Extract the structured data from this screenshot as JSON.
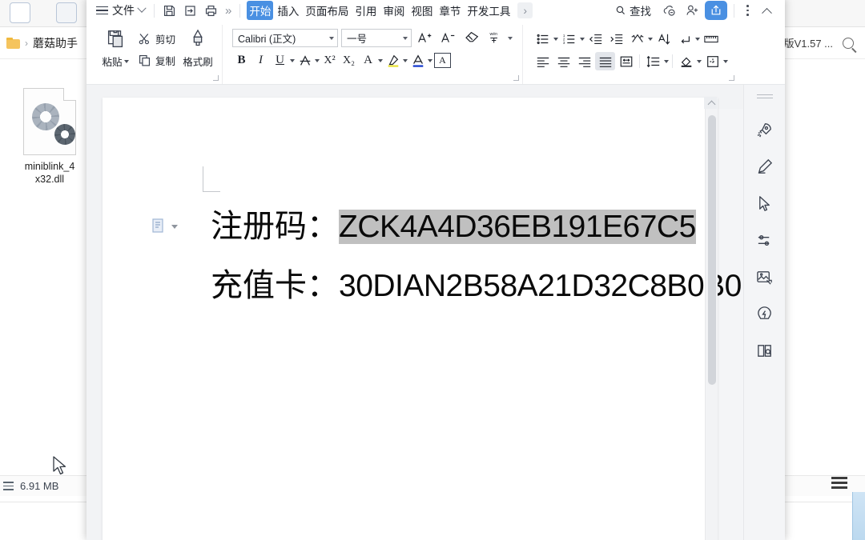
{
  "explorer": {
    "breadcrumb_folder_icon": "folder-icon",
    "breadcrumb_sep": "›",
    "breadcrumb_text": "蘑菇助手",
    "right_breadcrumb_sep": "›",
    "right_breadcrumb_text": "版V1.57 ...",
    "search_icon": "search-icon",
    "file": {
      "icon": "dll-gears-icon",
      "name_line1": "miniblink_4",
      "name_line2": "x32.dll"
    },
    "status": {
      "list_icon": "list-view-icon",
      "size_text": "6.91 MB"
    },
    "cursor": "mouse-cursor"
  },
  "wps": {
    "menubar": {
      "hamburger_icon": "hamburger-icon",
      "file_label": "文件",
      "file_caret_icon": "chevron-down-icon",
      "quick_icons": [
        "save-icon",
        "export-pdf-icon",
        "print-icon"
      ],
      "quick_more": "»",
      "tabs": [
        {
          "label": "开始",
          "active": true
        },
        {
          "label": "插入",
          "active": false
        },
        {
          "label": "页面布局",
          "active": false
        },
        {
          "label": "引用",
          "active": false
        },
        {
          "label": "审阅",
          "active": false
        },
        {
          "label": "视图",
          "active": false
        },
        {
          "label": "章节",
          "active": false
        },
        {
          "label": "开发工具",
          "active": false
        }
      ],
      "tabs_overflow": "›",
      "find_icon": "search-icon",
      "find_label": "查找",
      "cloud_icon": "cloud-off-icon",
      "add_user_icon": "add-user-icon",
      "share_icon": "share-icon",
      "overflow_icon": "more-vertical-icon",
      "collapse_icon": "chevron-up-icon"
    },
    "ribbon": {
      "clipboard": {
        "paste_icon": "paste-icon",
        "paste_label": "粘贴",
        "cut_icon": "scissors-icon",
        "cut_label": "剪切",
        "copy_icon": "copy-icon",
        "copy_label": "复制",
        "format_painter_icon": "format-painter-icon",
        "format_painter_label": "格式刷"
      },
      "font": {
        "font_name": "Calibri (正文)",
        "font_size": "一号",
        "grow_font_icon": "increase-font-icon",
        "shrink_font_icon": "decrease-font-icon",
        "clear_format_icon": "clear-format-icon",
        "pinyin_icon": "pinyin-guide-icon",
        "bold_label": "B",
        "italic_label": "I",
        "underline_label": "U",
        "strikethrough_icon": "strikethrough-icon",
        "superscript_label": "X²",
        "subscript_label": "X₂",
        "text_effect_label": "A",
        "highlight_icon": "highlight-icon",
        "font_color_icon": "font-color-icon",
        "char_border_label": "A"
      },
      "paragraph": {
        "bullets_icon": "bullet-list-icon",
        "numbering_icon": "numbered-list-icon",
        "decrease_indent_icon": "decrease-indent-icon",
        "increase_indent_icon": "increase-indent-icon",
        "smart_layout_icon": "smart-layout-icon",
        "sort_icon": "sort-icon",
        "show_marks_icon": "show-paragraph-marks-icon",
        "ruler_icon": "ruler-icon",
        "align_left_icon": "align-left-icon",
        "align_center_icon": "align-center-icon",
        "align_right_icon": "align-right-icon",
        "align_justify_icon": "align-justify-icon",
        "distribute_icon": "distribute-text-icon",
        "line_spacing_icon": "line-spacing-icon",
        "shading_icon": "shading-icon",
        "borders_icon": "borders-icon"
      }
    },
    "document": {
      "paste_options_icon": "paste-options-icon",
      "paste_options_caret": "chevron-down-icon",
      "lines": [
        {
          "label": "注册码：",
          "value": "ZCK4A4D36EB191E67C5",
          "highlighted": true
        },
        {
          "label": "充值卡：",
          "value": "30DIAN2B58A21D32C8B0B0",
          "highlighted": false
        }
      ],
      "highlight_color": "#c0c0c0",
      "scrollbar": {
        "up_arrow_icon": "scroll-up-arrow-icon",
        "thumb": "scrollbar-thumb"
      }
    },
    "rail": {
      "handle_icon": "drag-handle-icon",
      "items": [
        "rocket-icon",
        "pen-icon",
        "cursor-select-icon",
        "sliders-icon",
        "image-tools-icon",
        "lightning-idea-icon",
        "book-search-icon"
      ]
    }
  },
  "colors": {
    "accent": "#4a90e2",
    "highlight": "#c0c0c0",
    "ribbon_bg": "#ffffff",
    "doc_bg": "#f2f3f5"
  }
}
